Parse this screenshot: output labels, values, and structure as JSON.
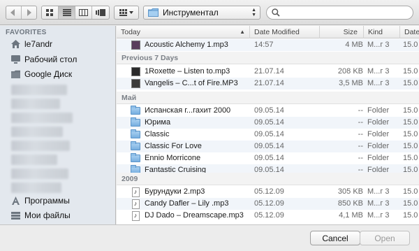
{
  "toolbar": {
    "path_label": "Инструментал",
    "search": {
      "value": "",
      "placeholder": ""
    }
  },
  "sidebar": {
    "heading": "FAVORITES",
    "items": [
      {
        "label": "le7andr",
        "icon": "home-icon"
      },
      {
        "label": "Рабочий стол",
        "icon": "desktop-icon"
      },
      {
        "label": "Google Диск",
        "icon": "folder-icon"
      },
      {
        "label": "Программы",
        "icon": "applications-icon"
      },
      {
        "label": "Мои файлы",
        "icon": "all-my-files-icon"
      }
    ]
  },
  "columns": {
    "name": "Today",
    "date": "Date Modified",
    "size": "Size",
    "kind": "Kind",
    "date2": "Date"
  },
  "groups": {
    "previous7": "Previous 7 Days",
    "may": "Май",
    "y2009": "2009"
  },
  "rows": [
    {
      "name": "Acoustic Alchemy 1.mp3",
      "date": "14:57",
      "size": "4 MB",
      "kind": "М...г 3",
      "date2": "15.0",
      "icon": "album-art-icon",
      "art": "#5a3e5c"
    },
    {
      "name": "1Roxette – Listen to.mp3",
      "date": "21.07.14",
      "size": "208 KB",
      "kind": "М...г 3",
      "date2": "15.0",
      "icon": "album-art-icon",
      "art": "#2a2a2a"
    },
    {
      "name": "Vangelis – C...t of Fire.MP3",
      "date": "21.07.14",
      "size": "3,5 MB",
      "kind": "М...г 3",
      "date2": "15.0",
      "icon": "album-art-icon",
      "art": "#3b3b3b"
    },
    {
      "name": "Испанская г...гахит 2000",
      "date": "09.05.14",
      "size": "--",
      "kind": "Folder",
      "date2": "15.0",
      "icon": "folder-icon"
    },
    {
      "name": "Юрима",
      "date": "09.05.14",
      "size": "--",
      "kind": "Folder",
      "date2": "15.0",
      "icon": "folder-icon"
    },
    {
      "name": "Classic",
      "date": "09.05.14",
      "size": "--",
      "kind": "Folder",
      "date2": "15.0",
      "icon": "folder-icon"
    },
    {
      "name": "Classic For Love",
      "date": "09.05.14",
      "size": "--",
      "kind": "Folder",
      "date2": "15.0",
      "icon": "folder-icon"
    },
    {
      "name": "Ennio Morricone",
      "date": "09.05.14",
      "size": "--",
      "kind": "Folder",
      "date2": "15.0",
      "icon": "folder-icon"
    },
    {
      "name": "Fantastic Cruising",
      "date": "09.05.14",
      "size": "--",
      "kind": "Folder",
      "date2": "15.0",
      "icon": "folder-icon"
    },
    {
      "name": "Бурундуки 2.mp3",
      "date": "05.12.09",
      "size": "305 KB",
      "kind": "М...г 3",
      "date2": "15.0",
      "icon": "music-file-icon"
    },
    {
      "name": "Candy Dafler – Lily .mp3",
      "date": "05.12.09",
      "size": "850 KB",
      "kind": "М...г 3",
      "date2": "15.0",
      "icon": "music-file-icon"
    },
    {
      "name": "DJ Dado – Dreamscape.mp3",
      "date": "05.12.09",
      "size": "4,1 MB",
      "kind": "М...г 3",
      "date2": "15.0",
      "icon": "music-file-icon"
    }
  ],
  "buttons": {
    "cancel": "Cancel",
    "open": "Open"
  }
}
